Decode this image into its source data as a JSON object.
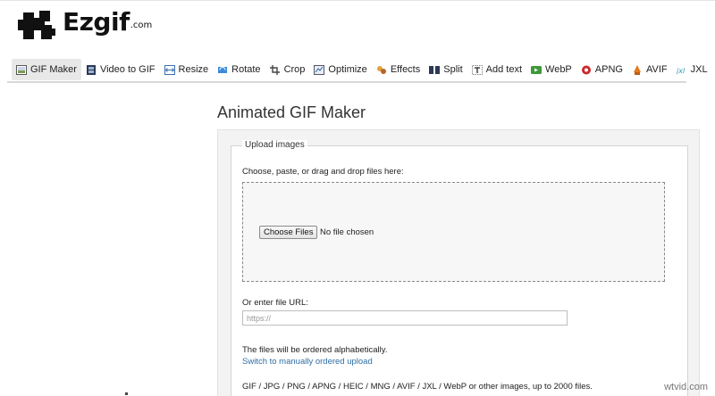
{
  "brand": {
    "name": "Ezgif",
    "suffix": ".com"
  },
  "nav": [
    {
      "label": "GIF Maker",
      "icon": "gif-maker-icon",
      "active": true
    },
    {
      "label": "Video to GIF",
      "icon": "film-icon"
    },
    {
      "label": "Resize",
      "icon": "resize-icon"
    },
    {
      "label": "Rotate",
      "icon": "rotate-icon"
    },
    {
      "label": "Crop",
      "icon": "crop-icon"
    },
    {
      "label": "Optimize",
      "icon": "optimize-icon"
    },
    {
      "label": "Effects",
      "icon": "effects-icon"
    },
    {
      "label": "Split",
      "icon": "split-icon"
    },
    {
      "label": "Add text",
      "icon": "text-icon"
    },
    {
      "label": "WebP",
      "icon": "webp-icon"
    },
    {
      "label": "APNG",
      "icon": "apng-icon"
    },
    {
      "label": "AVIF",
      "icon": "avif-icon"
    },
    {
      "label": "JXL",
      "icon": "jxl-icon"
    }
  ],
  "page": {
    "title": "Animated GIF Maker"
  },
  "upload": {
    "legend": "Upload images",
    "choose_label": "Choose, paste, or drag and drop files here:",
    "choose_button": "Choose Files",
    "no_file": "No file chosen",
    "url_label": "Or enter file URL:",
    "url_placeholder": "https://",
    "order_note": "The files will be ordered alphabetically.",
    "order_link": "Switch to manually ordered upload",
    "formats_note": "GIF / JPG / PNG / APNG / HEIC / MNG / AVIF / JXL / WebP or other images, up to 2000 files."
  },
  "watermark": "wtvid.com",
  "colors": {
    "link": "#2e6da4",
    "nav_active_bg": "#e8e8e8",
    "panel_bg": "#f3f3f3"
  }
}
